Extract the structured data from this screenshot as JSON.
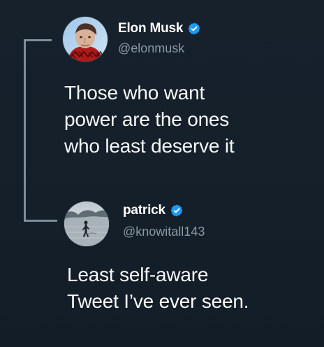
{
  "colors": {
    "background": "#15202b",
    "text": "#ffffff",
    "muted": "#8b98a5",
    "verified": "#1d9bf0",
    "thread_line": "#8b98a5"
  },
  "thread": {
    "primary": {
      "display_name": "Elon Musk",
      "handle": "@elonmusk",
      "text": "Those who want\npower are the ones\nwho least deserve it",
      "avatar_icon": "profile-avatar",
      "verified_icon": "verified-badge"
    },
    "reply": {
      "display_name": "patrick",
      "handle": "@knowitall143",
      "text": "Least self-aware\nTweet I’ve ever seen.",
      "avatar_icon": "profile-avatar",
      "verified_icon": "verified-badge"
    }
  }
}
